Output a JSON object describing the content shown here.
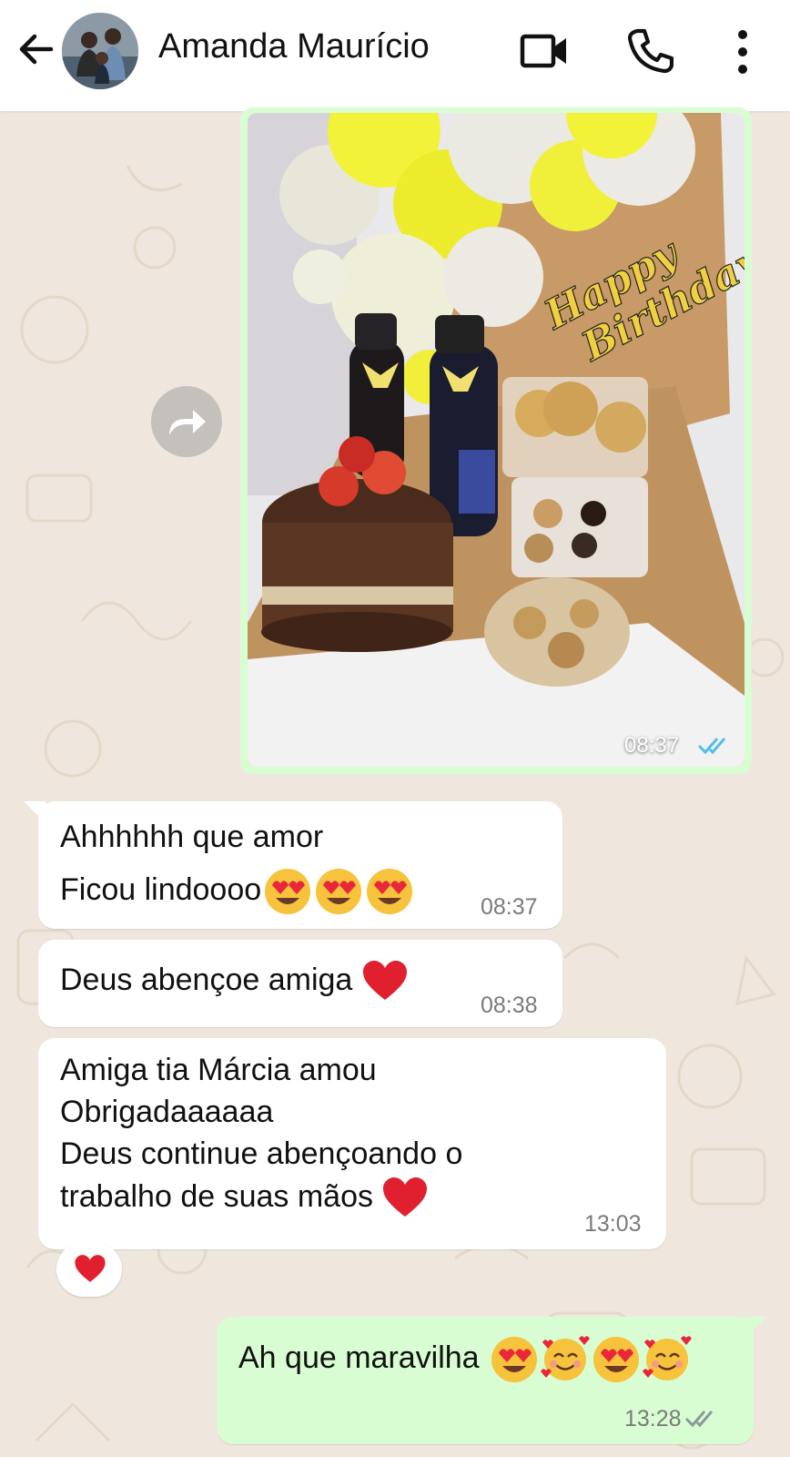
{
  "header": {
    "contact_name": "Amanda Maurício"
  },
  "icons": {
    "back": "arrow-left-icon",
    "video": "video-camera-icon",
    "call": "phone-icon",
    "menu": "more-vertical-icon",
    "forward": "forward-icon",
    "read_receipt": "double-check-icon",
    "heart": "red-heart-emoji",
    "heart_eyes": "heart-eyes-emoji",
    "smiling_hearts": "smiling-face-with-hearts-emoji"
  },
  "messages": {
    "image_message": {
      "photo_text": [
        "Happy",
        "Birthday"
      ],
      "time": "08:37"
    },
    "msg1": {
      "lines": [
        "Ahhhhhh que amor",
        "Ficou lindoooo"
      ],
      "time": "08:37"
    },
    "msg2": {
      "lines": [
        "Deus abençoe amiga"
      ],
      "time": "08:38"
    },
    "msg3": {
      "lines": [
        "Amiga tia Márcia amou",
        "Obrigadaaaaaa",
        "Deus continue abençoando o",
        "trabalho de suas mãos"
      ],
      "time": "13:03"
    },
    "msg4": {
      "lines": [
        "Ah que maravilha"
      ],
      "time": "13:28"
    }
  },
  "colors": {
    "wallpaper": "#efe7dd",
    "outgoing_bubble": "#d9fdd3",
    "incoming_bubble": "#ffffff",
    "read_tick": "#53bdeb",
    "heart": "#e0202f"
  }
}
